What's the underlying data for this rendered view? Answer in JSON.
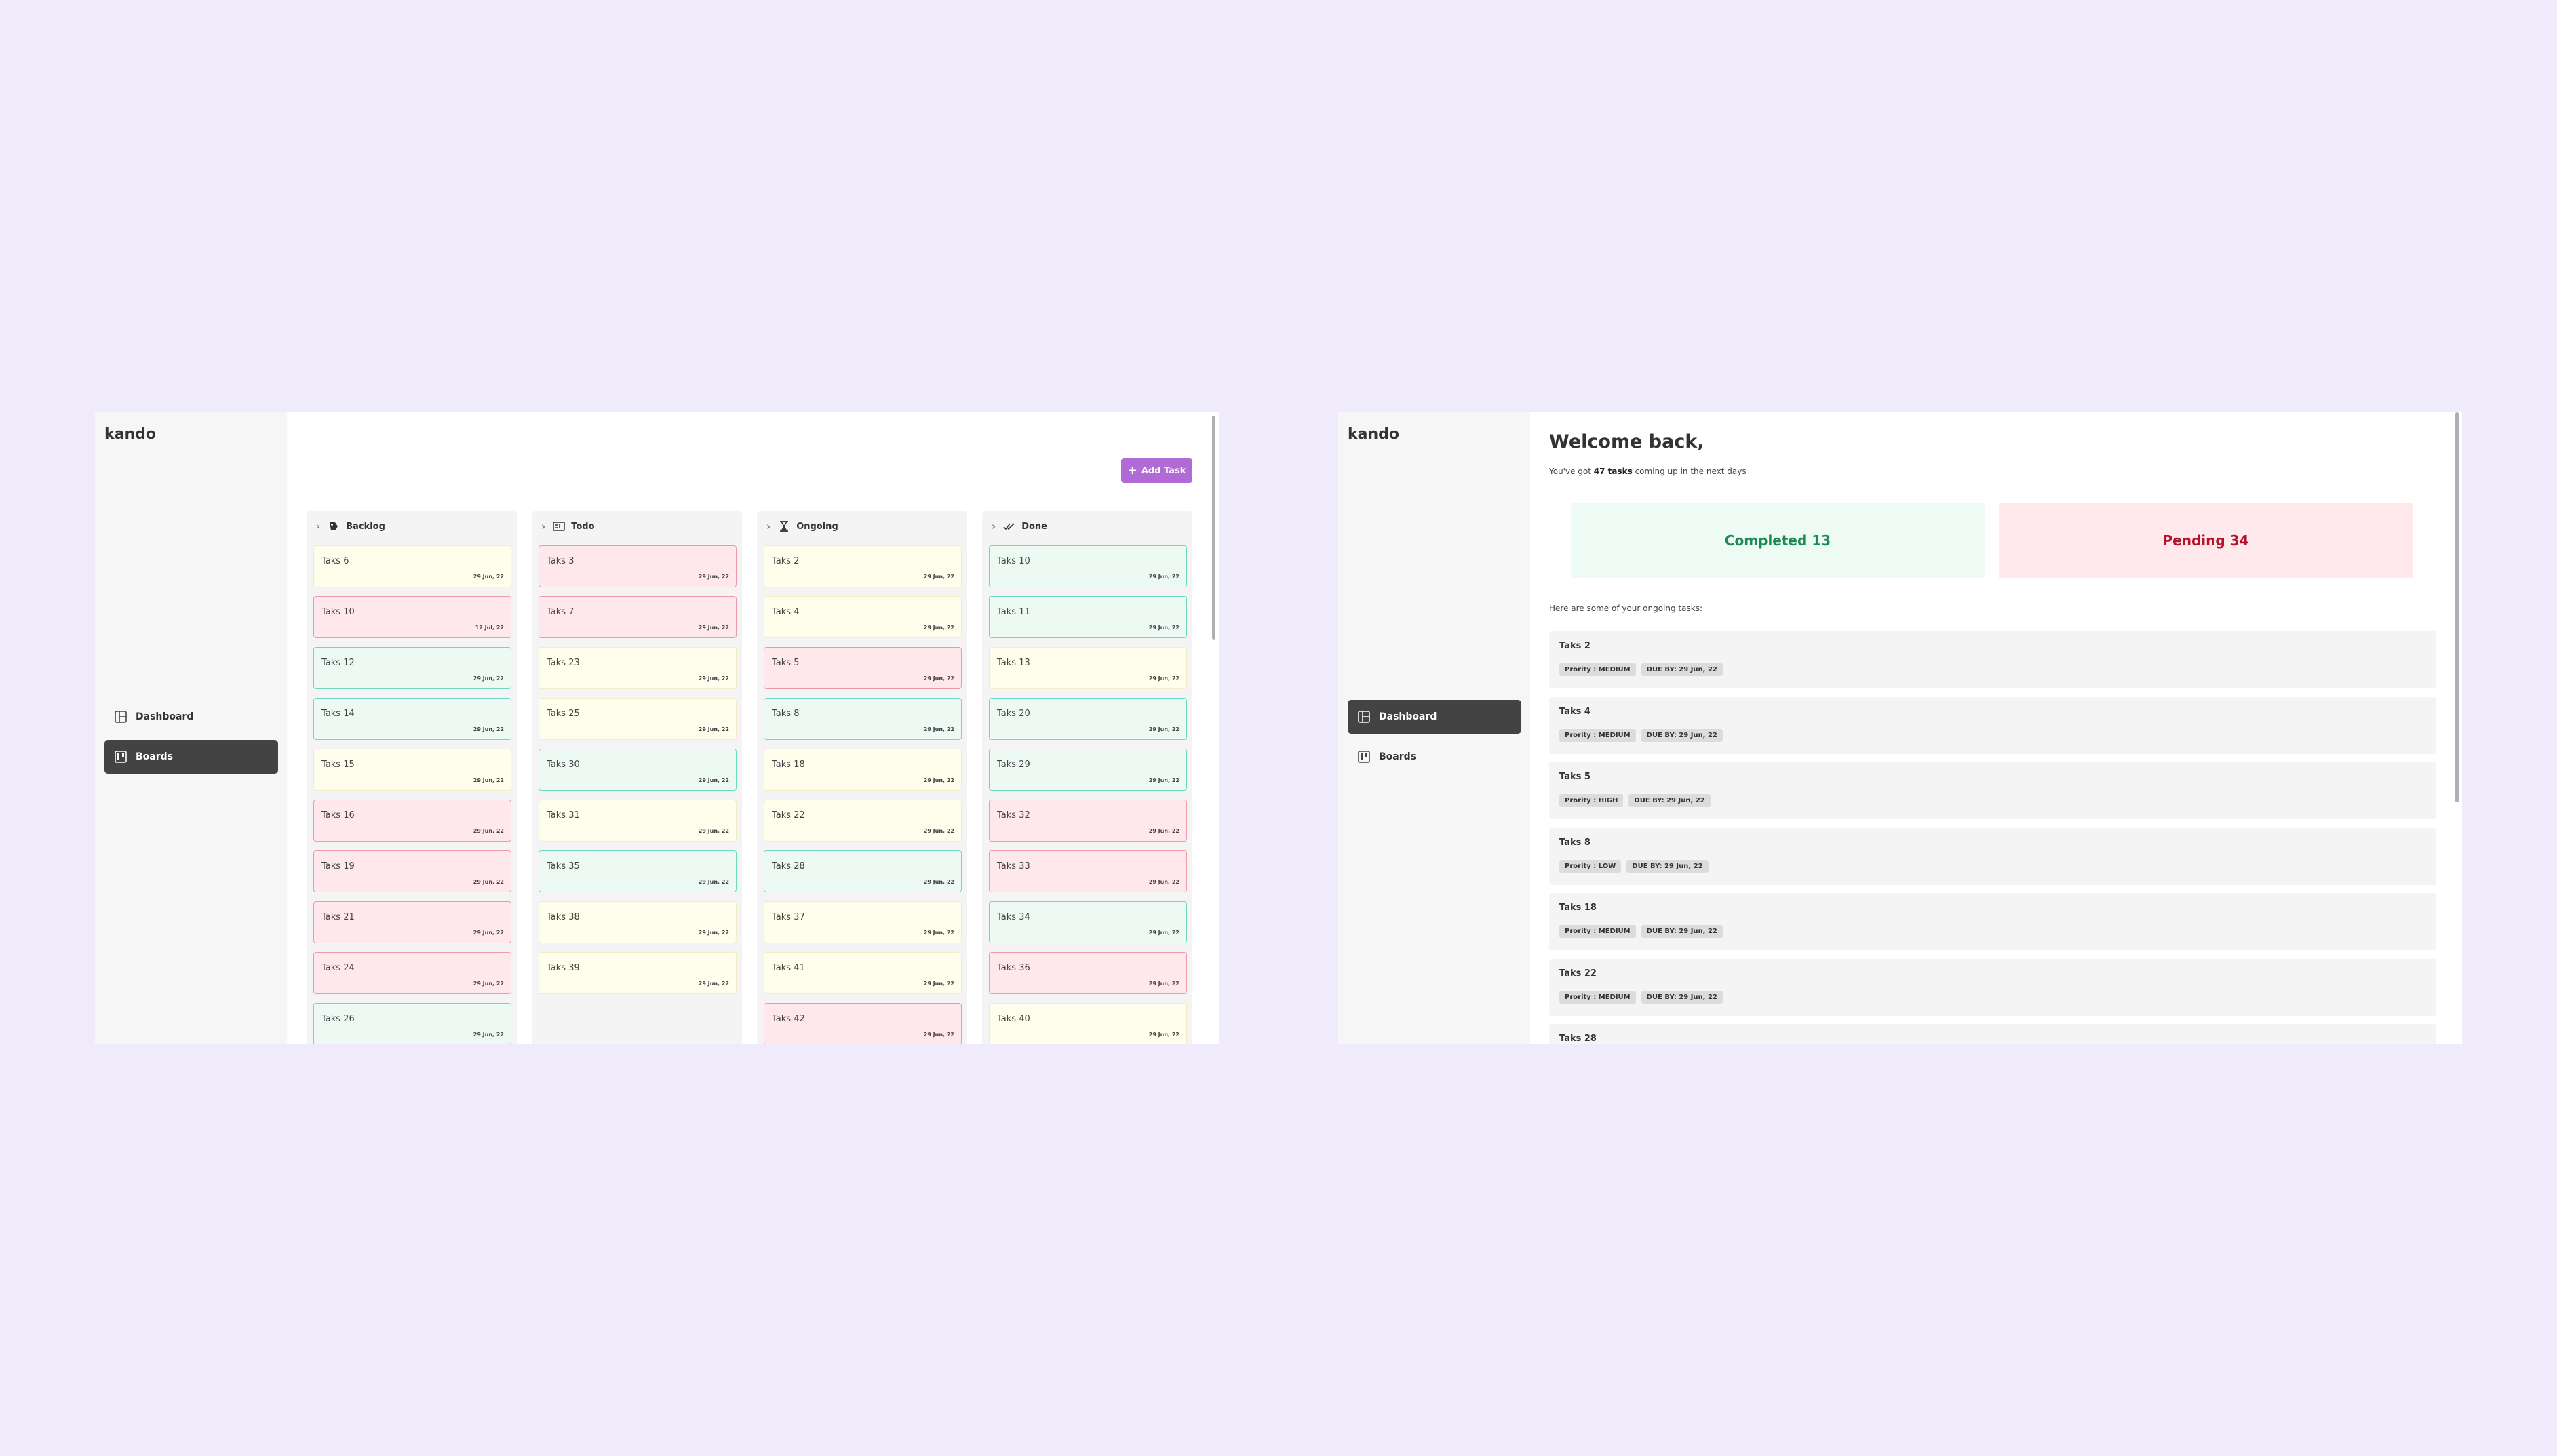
{
  "board_view": {
    "logo": "kando",
    "nav": [
      {
        "label": "Dashboard",
        "icon": "dashboard-icon",
        "active": false
      },
      {
        "label": "Boards",
        "icon": "boards-icon",
        "active": true
      }
    ],
    "add_task_label": "Add Task",
    "columns": [
      {
        "title": "Backlog",
        "icon": "backlog-icon",
        "cards": [
          {
            "title": "Taks 6",
            "date": "29 Jun, 22",
            "priority": "medium"
          },
          {
            "title": "Taks 10",
            "date": "12 Jul, 22",
            "priority": "high"
          },
          {
            "title": "Taks 12",
            "date": "29 Jun, 22",
            "priority": "low"
          },
          {
            "title": "Taks 14",
            "date": "29 Jun, 22",
            "priority": "low"
          },
          {
            "title": "Taks 15",
            "date": "29 Jun, 22",
            "priority": "medium"
          },
          {
            "title": "Taks 16",
            "date": "29 Jun, 22",
            "priority": "high"
          },
          {
            "title": "Taks 19",
            "date": "29 Jun, 22",
            "priority": "high"
          },
          {
            "title": "Taks 21",
            "date": "29 Jun, 22",
            "priority": "high"
          },
          {
            "title": "Taks 24",
            "date": "29 Jun, 22",
            "priority": "high"
          },
          {
            "title": "Taks 26",
            "date": "29 Jun, 22",
            "priority": "low"
          }
        ]
      },
      {
        "title": "Todo",
        "icon": "todo-icon",
        "cards": [
          {
            "title": "Taks 3",
            "date": "29 Jun, 22",
            "priority": "high"
          },
          {
            "title": "Taks 7",
            "date": "29 Jun, 22",
            "priority": "high"
          },
          {
            "title": "Taks 23",
            "date": "29 Jun, 22",
            "priority": "medium"
          },
          {
            "title": "Taks 25",
            "date": "29 Jun, 22",
            "priority": "medium"
          },
          {
            "title": "Taks 30",
            "date": "29 Jun, 22",
            "priority": "low"
          },
          {
            "title": "Taks 31",
            "date": "29 Jun, 22",
            "priority": "medium"
          },
          {
            "title": "Taks 35",
            "date": "29 Jun, 22",
            "priority": "low"
          },
          {
            "title": "Taks 38",
            "date": "29 Jun, 22",
            "priority": "medium"
          },
          {
            "title": "Taks 39",
            "date": "29 Jun, 22",
            "priority": "medium"
          }
        ]
      },
      {
        "title": "Ongoing",
        "icon": "hourglass-icon",
        "cards": [
          {
            "title": "Taks 2",
            "date": "29 Jun, 22",
            "priority": "medium"
          },
          {
            "title": "Taks 4",
            "date": "29 Jun, 22",
            "priority": "medium"
          },
          {
            "title": "Taks 5",
            "date": "29 Jun, 22",
            "priority": "high"
          },
          {
            "title": "Taks 8",
            "date": "29 Jun, 22",
            "priority": "low"
          },
          {
            "title": "Taks 18",
            "date": "29 Jun, 22",
            "priority": "medium"
          },
          {
            "title": "Taks 22",
            "date": "29 Jun, 22",
            "priority": "medium"
          },
          {
            "title": "Taks 28",
            "date": "29 Jun, 22",
            "priority": "low"
          },
          {
            "title": "Taks 37",
            "date": "29 Jun, 22",
            "priority": "medium"
          },
          {
            "title": "Taks 41",
            "date": "29 Jun, 22",
            "priority": "medium"
          },
          {
            "title": "Taks 42",
            "date": "29 Jun, 22",
            "priority": "high"
          }
        ]
      },
      {
        "title": "Done",
        "icon": "double-check-icon",
        "cards": [
          {
            "title": "Taks 10",
            "date": "29 Jun, 22",
            "priority": "low"
          },
          {
            "title": "Taks 11",
            "date": "29 Jun, 22",
            "priority": "low"
          },
          {
            "title": "Taks 13",
            "date": "29 Jun, 22",
            "priority": "medium"
          },
          {
            "title": "Taks 20",
            "date": "29 Jun, 22",
            "priority": "low"
          },
          {
            "title": "Taks 29",
            "date": "29 Jun, 22",
            "priority": "low"
          },
          {
            "title": "Taks 32",
            "date": "29 Jun, 22",
            "priority": "high"
          },
          {
            "title": "Taks 33",
            "date": "29 Jun, 22",
            "priority": "high"
          },
          {
            "title": "Taks 34",
            "date": "29 Jun, 22",
            "priority": "low"
          },
          {
            "title": "Taks 36",
            "date": "29 Jun, 22",
            "priority": "high"
          },
          {
            "title": "Taks 40",
            "date": "29 Jun, 22",
            "priority": "medium"
          }
        ]
      }
    ]
  },
  "dashboard_view": {
    "logo": "kando",
    "nav": [
      {
        "label": "Dashboard",
        "icon": "dashboard-icon",
        "active": true
      },
      {
        "label": "Boards",
        "icon": "boards-icon",
        "active": false
      }
    ],
    "welcome": "Welcome back,",
    "subline_prefix": "You've got ",
    "subline_bold": "47 tasks",
    "subline_suffix": " coming up in the next days",
    "completed_label": "Completed 13",
    "pending_label": "Pending 34",
    "ongoing_label": "Here are some of your ongoing tasks:",
    "ongoing_tasks": [
      {
        "title": "Taks 2",
        "priority": "Prority : MEDIUM",
        "due": "DUE BY: 29 Jun, 22"
      },
      {
        "title": "Taks 4",
        "priority": "Prority : MEDIUM",
        "due": "DUE BY: 29 Jun, 22"
      },
      {
        "title": "Taks 5",
        "priority": "Prority : HIGH",
        "due": "DUE BY: 29 Jun, 22"
      },
      {
        "title": "Taks 8",
        "priority": "Prority : LOW",
        "due": "DUE BY: 29 Jun, 22"
      },
      {
        "title": "Taks 18",
        "priority": "Prority : MEDIUM",
        "due": "DUE BY: 29 Jun, 22"
      },
      {
        "title": "Taks 22",
        "priority": "Prority : MEDIUM",
        "due": "DUE BY: 29 Jun, 22"
      },
      {
        "title": "Taks 28",
        "priority": "",
        "due": ""
      }
    ]
  },
  "colors": {
    "page_bg": "#efebfa",
    "accent": "#b06bd6",
    "low": "#6ed9bf",
    "medium": "#f3ecc6",
    "high": "#ec9aa8",
    "completed_text": "#1b8a55",
    "pending_text": "#b3122a"
  }
}
